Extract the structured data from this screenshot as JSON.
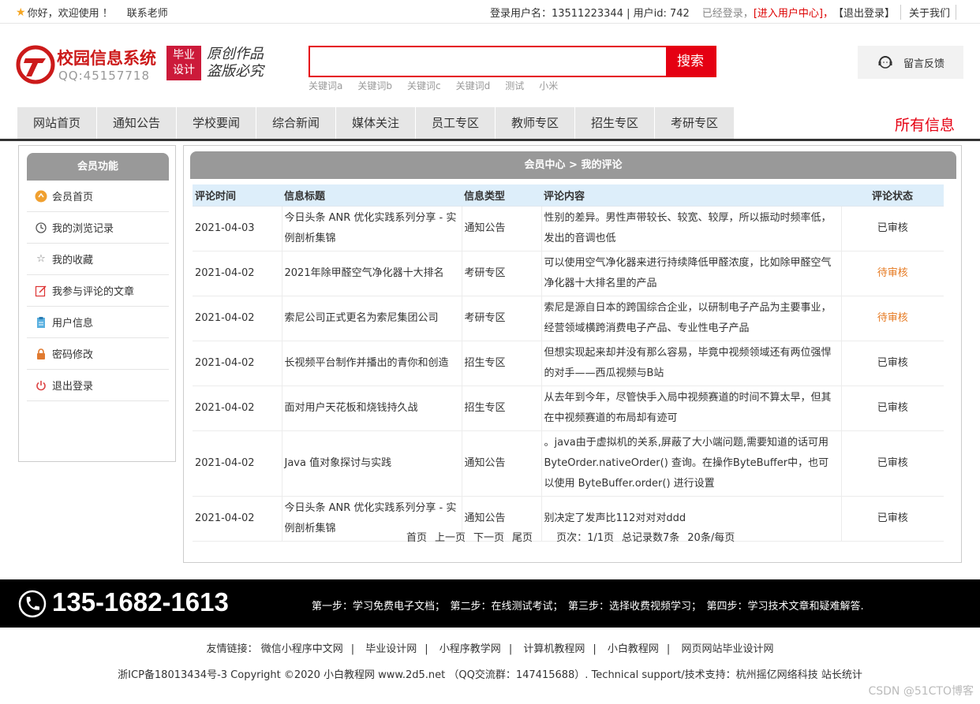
{
  "topbar": {
    "welcome": "你好，欢迎使用 ！",
    "contact": "联系老师",
    "login_user": "登录用户名：13511223344 | 用户id: 742",
    "logged_in": "已经登录，",
    "user_center": "[进入用户中心]，",
    "logout": "【退出登录】",
    "about": "关于我们"
  },
  "header": {
    "title": "校园信息系统",
    "qq": "QQ:45157718",
    "badge_line1": "毕业",
    "badge_line2": "设计",
    "slogan_line1": "原创作品",
    "slogan_line2": "盗版必究",
    "search_placeholder": "",
    "search_button": "搜索",
    "keywords": [
      "关键词a",
      "关键词b",
      "关键词c",
      "关键词d",
      "测试",
      "小米"
    ],
    "feedback": "留言反馈"
  },
  "nav": {
    "items": [
      "网站首页",
      "通知公告",
      "学校要闻",
      "综合新闻",
      "媒体关注",
      "员工专区",
      "教师专区",
      "招生专区",
      "考研专区"
    ],
    "all_info": "所有信息"
  },
  "sidebar": {
    "title": "会员功能",
    "items": [
      {
        "label": "会员首页",
        "icon": "home-icon"
      },
      {
        "label": "我的浏览记录",
        "icon": "history-icon"
      },
      {
        "label": "我的收藏",
        "icon": "star-icon"
      },
      {
        "label": "我参与评论的文章",
        "icon": "edit-icon"
      },
      {
        "label": "用户信息",
        "icon": "clipboard-icon"
      },
      {
        "label": "密码修改",
        "icon": "lock-icon"
      },
      {
        "label": "退出登录",
        "icon": "power-icon"
      }
    ]
  },
  "main": {
    "breadcrumb": "会员中心 > 我的评论",
    "columns": [
      "评论时间",
      "信息标题",
      "信息类型",
      "评论内容",
      "评论状态"
    ],
    "rows": [
      {
        "time": "2021-04-03",
        "title": "今日头条 ANR 优化实践系列分享 - 实例剖析集锦",
        "type": "通知公告",
        "content": "性别的差异。男性声带较长、较宽、较厚，所以振动时频率低，发出的音调也低",
        "status": "已审核",
        "pending": false
      },
      {
        "time": "2021-04-02",
        "title": "2021年除甲醛空气净化器十大排名",
        "type": "考研专区",
        "content": "可以使用空气净化器来进行持续降低甲醛浓度，比如除甲醛空气净化器十大排名里的产品",
        "status": "待审核",
        "pending": true
      },
      {
        "time": "2021-04-02",
        "title": "索尼公司正式更名为索尼集团公司",
        "type": "考研专区",
        "content": "索尼是源自日本的跨国综合企业，以研制电子产品为主要事业，经营领域横跨消费电子产品、专业性电子产品",
        "status": "待审核",
        "pending": true
      },
      {
        "time": "2021-04-02",
        "title": "长视频平台制作并播出的青你和创造",
        "type": "招生专区",
        "content": "但想实现起来却并没有那么容易，毕竟中视频领域还有两位强悍的对手——西瓜视频与B站",
        "status": "已审核",
        "pending": false
      },
      {
        "time": "2021-04-02",
        "title": "面对用户天花板和烧钱持久战",
        "type": "招生专区",
        "content": "从去年到今年，尽管快手入局中视频赛道的时间不算太早，但其在中视频赛道的布局却有迹可",
        "status": "已审核",
        "pending": false
      },
      {
        "time": "2021-04-02",
        "title": "Java 值对象探讨与实践",
        "type": "通知公告",
        "content": "。java由于虚拟机的关系,屏蔽了大小端问题,需要知道的话可用 ByteOrder.nativeOrder() 查询。在操作ByteBuffer中，也可以使用 ByteBuffer.order() 进行设置",
        "status": "已审核",
        "pending": false
      },
      {
        "time": "2021-04-02",
        "title": "今日头条 ANR 优化实践系列分享 - 实例剖析集锦",
        "type": "通知公告",
        "content": "别决定了发声比112对对对ddd",
        "status": "已审核",
        "pending": false
      }
    ],
    "pager": {
      "first": "首页",
      "prev": "上一页",
      "next": "下一页",
      "last": "尾页",
      "page": "页次：1/1页",
      "total": "总记录数7条",
      "per": "20条/每页"
    }
  },
  "footer": {
    "phone": "135-1682-1613",
    "steps": "第一步：学习免费电子文档；　第二步：在线测试考试；　第三步：选择收费视频学习；　第四步：学习技术文章和疑难解答.",
    "links_label": "友情链接：",
    "links": [
      "微信小程序中文网",
      "毕业设计网",
      "小程序教学网",
      "计算机教程网",
      "小白教程网",
      "网页网站毕业设计网"
    ],
    "icp": "浙ICP备18013434号-3 Copyright ©2020 小白教程网 www.2d5.net （QQ交流群：147415688）. Technical support/技术支持：杭州摇亿网络科技 站长统计",
    "watermark": "CSDN @51CTO博客"
  },
  "colors": {
    "brand_red": "#e50012",
    "pending_orange": "#e67a22",
    "nav_bg": "#e6e6e6",
    "panel_gray": "#999999"
  }
}
